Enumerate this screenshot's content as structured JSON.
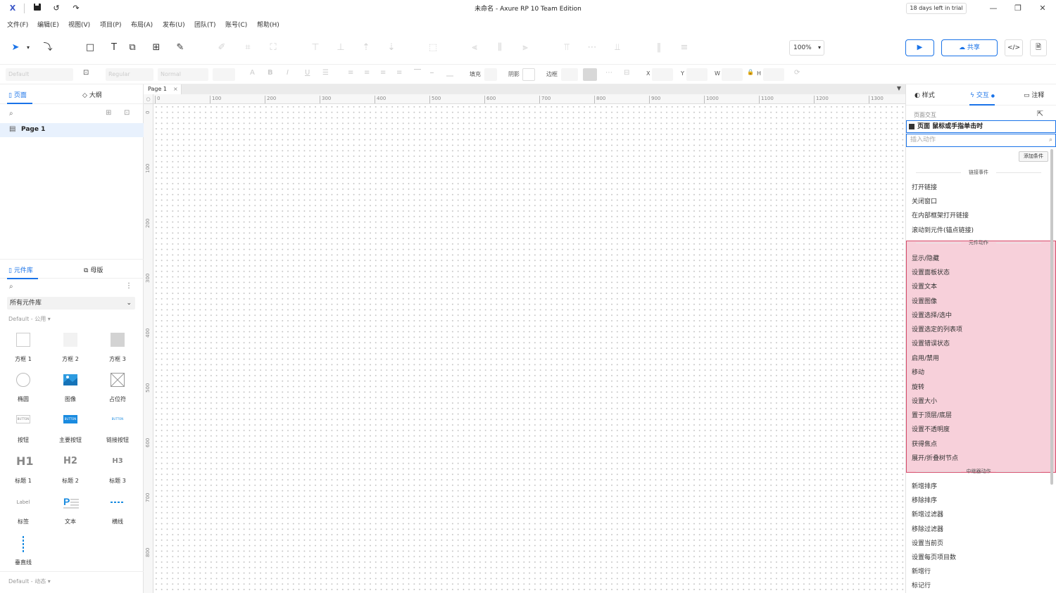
{
  "window": {
    "title": "未命名 - Axure RP 10 Team Edition",
    "trial_badge": "18 days left in trial"
  },
  "menubar": [
    "文件(F)",
    "编辑(E)",
    "视图(V)",
    "项目(P)",
    "布局(A)",
    "发布(U)",
    "团队(T)",
    "账号(C)",
    "帮助(H)"
  ],
  "toolbar": {
    "zoom": "100%",
    "share_label": "共享"
  },
  "stylebar": {
    "font_family": "Default",
    "font_style": "Regular",
    "font_weight": "Normal",
    "fill_label": "填充",
    "shadow_label": "阴影",
    "border_label": "边框",
    "x_label": "X",
    "y_label": "Y",
    "w_label": "W",
    "h_label": "H"
  },
  "left_panel": {
    "tabs": [
      "页面",
      "大纲"
    ],
    "pages": [
      "Page 1"
    ],
    "lib_tabs": [
      "元件库",
      "母版"
    ],
    "lib_select": "所有元件库",
    "group_default_common": "Default - 公用",
    "group_default_dynamic": "Default - 动态",
    "widgets": [
      "方框 1",
      "方框 2",
      "方框 3",
      "椭圆",
      "图像",
      "占位符",
      "按钮",
      "主要按钮",
      "链接按钮",
      "标题 1",
      "标题 2",
      "标题 3",
      "标签",
      "文本",
      "横线",
      "垂直线"
    ],
    "widget_texts": {
      "button": "BUTTON",
      "primary_button": "BUTTON",
      "link_button": "BUTTON",
      "h1": "H1",
      "h2": "H2",
      "h3": "H3",
      "label": "Label"
    }
  },
  "canvas": {
    "tab": "Page 1",
    "tab_close": "×",
    "ruler_top": [
      "0",
      "100",
      "200",
      "300",
      "400",
      "500",
      "600",
      "700",
      "800",
      "900",
      "1000",
      "1100",
      "1200",
      "1300"
    ],
    "ruler_left": [
      "0",
      "100",
      "200",
      "300",
      "400",
      "500",
      "600",
      "700",
      "800"
    ]
  },
  "right_panel": {
    "tabs": [
      "样式",
      "交互",
      "注释"
    ],
    "page_interaction_label": "页面交互",
    "event_header": "页面 鼠标或手指单击时",
    "action_search_placeholder": "插入动作",
    "add_condition": "添加条件",
    "sections": {
      "link": "链接事件",
      "widget": "元件动作",
      "repeater": "中继器动作"
    },
    "link_actions": [
      "打开链接",
      "关闭窗口",
      "在内部框架打开链接",
      "滚动到元件(锚点链接)"
    ],
    "widget_actions": [
      "显示/隐藏",
      "设置面板状态",
      "设置文本",
      "设置图像",
      "设置选择/选中",
      "设置选定的列表项",
      "设置错误状态",
      "启用/禁用",
      "移动",
      "旋转",
      "设置大小",
      "置于顶层/底层",
      "设置不透明度",
      "获得焦点",
      "展开/折叠树节点"
    ],
    "repeater_actions": [
      "新增排序",
      "移除排序",
      "新增过滤器",
      "移除过滤器",
      "设置当前页",
      "设置每页项目数",
      "新增行",
      "标记行"
    ]
  },
  "colors": {
    "accent": "#1a73e8",
    "highlight": "#e87896"
  }
}
